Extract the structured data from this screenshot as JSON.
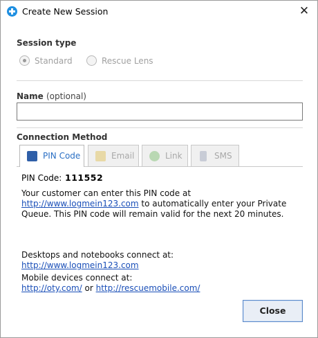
{
  "window": {
    "title": "Create New Session",
    "close_glyph": "✕"
  },
  "session_type": {
    "label": "Session type",
    "options": [
      {
        "label": "Standard",
        "selected": true,
        "enabled": false
      },
      {
        "label": "Rescue Lens",
        "selected": false,
        "enabled": false
      }
    ]
  },
  "name": {
    "label": "Name",
    "optional_hint": "(optional)",
    "value": "",
    "placeholder": ""
  },
  "connection_method": {
    "label": "Connection Method",
    "tabs": [
      {
        "label": "PIN Code",
        "icon": "pin-code-icon",
        "active": true
      },
      {
        "label": "Email",
        "icon": "email-icon",
        "active": false
      },
      {
        "label": "Link",
        "icon": "link-icon",
        "active": false
      },
      {
        "label": "SMS",
        "icon": "sms-icon",
        "active": false
      }
    ]
  },
  "pin": {
    "label": "PIN Code:",
    "value": "111552",
    "instructions_before": "Your customer can enter this PIN code at ",
    "instructions_link": "http://www.logmein123.com",
    "instructions_after": " to automatically enter your Private Queue. This PIN code will remain valid for the next 20 minutes."
  },
  "connect_info": {
    "desktops_label": "Desktops and notebooks connect at:",
    "desktops_link": "http://www.logmein123.com",
    "mobile_label": "Mobile devices connect at:",
    "mobile_link_1": "http://oty.com/",
    "mobile_or": " or ",
    "mobile_link_2": "http://rescuemobile.com/"
  },
  "buttons": {
    "close": "Close"
  },
  "colors": {
    "accent": "#1e8fe1",
    "link": "#1a4fb8",
    "active_tab_text": "#2a6fc4"
  }
}
